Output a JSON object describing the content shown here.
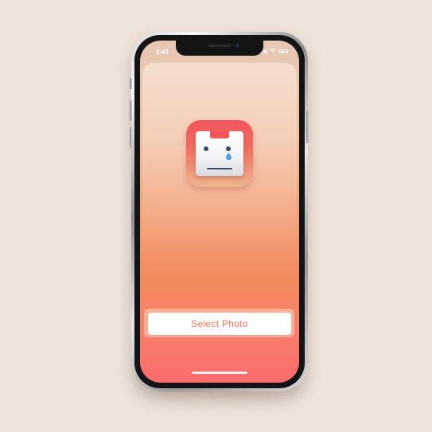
{
  "status_bar": {
    "time": "9:41",
    "icons": [
      "signal-icon",
      "wifi-icon",
      "battery-icon"
    ]
  },
  "app_icon": {
    "icon": "sad-robot-icon",
    "colors": {
      "top": "#f2545b",
      "bottom": "#f0b590",
      "eyes": "#3b4a66",
      "tear": "#4aa3e0"
    }
  },
  "main": {
    "select_photo_label": "Select Photo"
  },
  "colors": {
    "background": "#efe4da",
    "accent": "#f0735a",
    "gradient_top": "#e6c8b5",
    "gradient_bottom": "#fb6b6c"
  }
}
